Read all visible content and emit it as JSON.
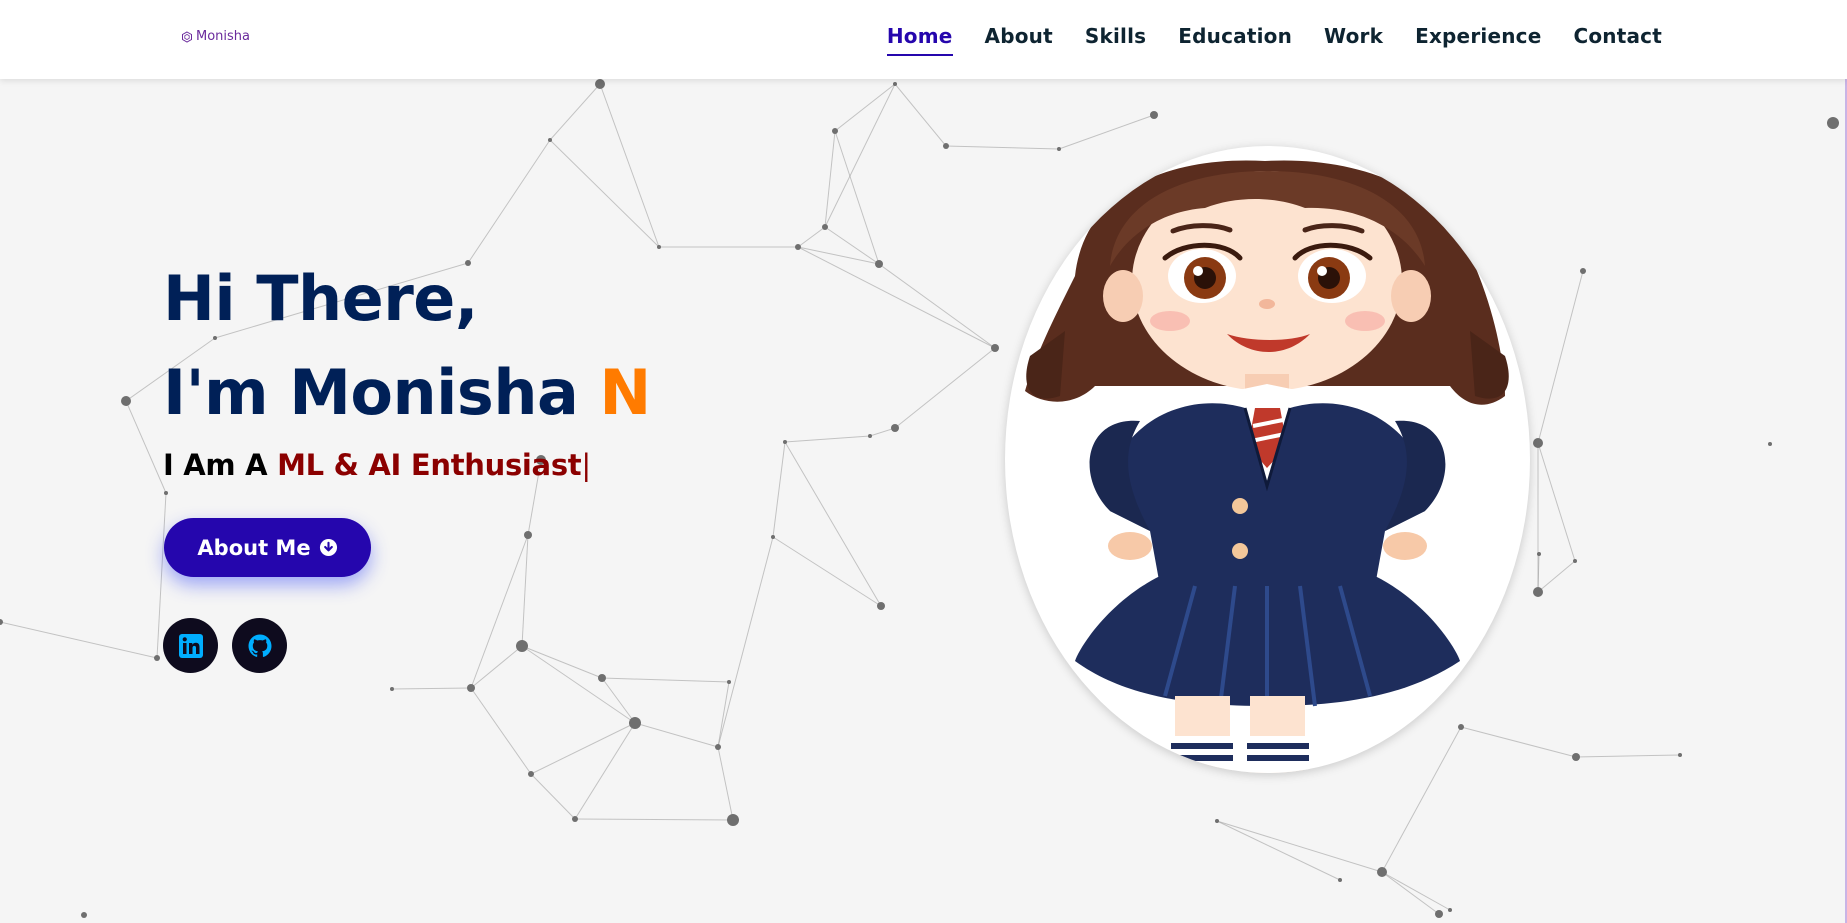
{
  "header": {
    "logo_text": "Monisha",
    "nav": [
      {
        "label": "Home",
        "active": true
      },
      {
        "label": "About",
        "active": false
      },
      {
        "label": "Skills",
        "active": false
      },
      {
        "label": "Education",
        "active": false
      },
      {
        "label": "Work",
        "active": false
      },
      {
        "label": "Experience",
        "active": false
      },
      {
        "label": "Contact",
        "active": false
      }
    ]
  },
  "hero": {
    "greeting": "Hi There,",
    "intro_prefix": "I'm Monisha ",
    "intro_accent": "N",
    "typing_prefix": "I Am A ",
    "typing_role": "ML & AI Enthusiast",
    "typing_cursor": "|",
    "button_label": "About Me",
    "button_icon": "arrow-circle-down-icon"
  },
  "social": [
    {
      "name": "linkedin",
      "icon": "linkedin-icon"
    },
    {
      "name": "github",
      "icon": "github-icon"
    }
  ],
  "colors": {
    "heading": "#002057",
    "accent": "#ff7b00",
    "role": "#8b0000",
    "button": "#2506ad",
    "nav_active": "#2506ad",
    "social_bg": "#0e0b1e",
    "social_icon": "#00aeff",
    "background": "#f5f5f5"
  }
}
